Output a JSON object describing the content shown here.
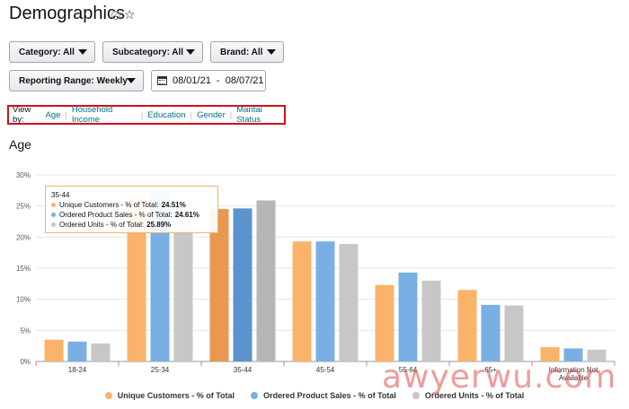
{
  "page": {
    "title": "Demographics"
  },
  "filters": {
    "category": "Category: All",
    "subcategory": "Subcategory: All",
    "brand": "Brand: All",
    "reporting_range": "Reporting Range: Weekly",
    "date_range": "08/01/21  -  08/07/21"
  },
  "view_by": {
    "label": "View by:",
    "options": [
      "Age",
      "Household Income",
      "Education",
      "Gender",
      "Marital Status"
    ]
  },
  "section": {
    "title": "Age"
  },
  "colors": {
    "unique_customers": "#fbb36b",
    "ordered_product_sales": "#7aafe3",
    "ordered_units": "#c7c7c7"
  },
  "tooltip": {
    "title": "35-44",
    "rows": [
      {
        "label": "Unique Customers - % of Total:",
        "value": "24.51%"
      },
      {
        "label": "Ordered Product Sales - % of Total:",
        "value": "24.61%"
      },
      {
        "label": "Ordered Units - % of Total:",
        "value": "25.89%"
      }
    ]
  },
  "chart_data": {
    "type": "bar",
    "categories": [
      "18-24",
      "25-34",
      "35-44",
      "45-54",
      "55-64",
      "65+",
      "Information Not Available"
    ],
    "series": [
      {
        "name": "Unique Customers - % of Total",
        "values": [
          3.5,
          26.5,
          24.51,
          19.3,
          12.3,
          11.5,
          2.3
        ]
      },
      {
        "name": "Ordered Product Sales - % of Total",
        "values": [
          3.2,
          27.2,
          24.61,
          19.3,
          14.3,
          9.1,
          2.1
        ]
      },
      {
        "name": "Ordered Units - % of Total",
        "values": [
          2.9,
          25.8,
          25.89,
          18.9,
          13.0,
          9.0,
          1.9
        ]
      }
    ],
    "y_ticks": [
      "0%",
      "5%",
      "10%",
      "15%",
      "20%",
      "25%",
      "30%"
    ],
    "ylim": [
      0,
      30
    ],
    "highlighted_category": "35-44",
    "legend_position": "bottom",
    "grid": true
  },
  "legend": {
    "items": [
      "Unique Customers - % of Total",
      "Ordered Product Sales - % of Total",
      "Ordered Units - % of Total"
    ]
  },
  "watermark": "awyerwu.com"
}
